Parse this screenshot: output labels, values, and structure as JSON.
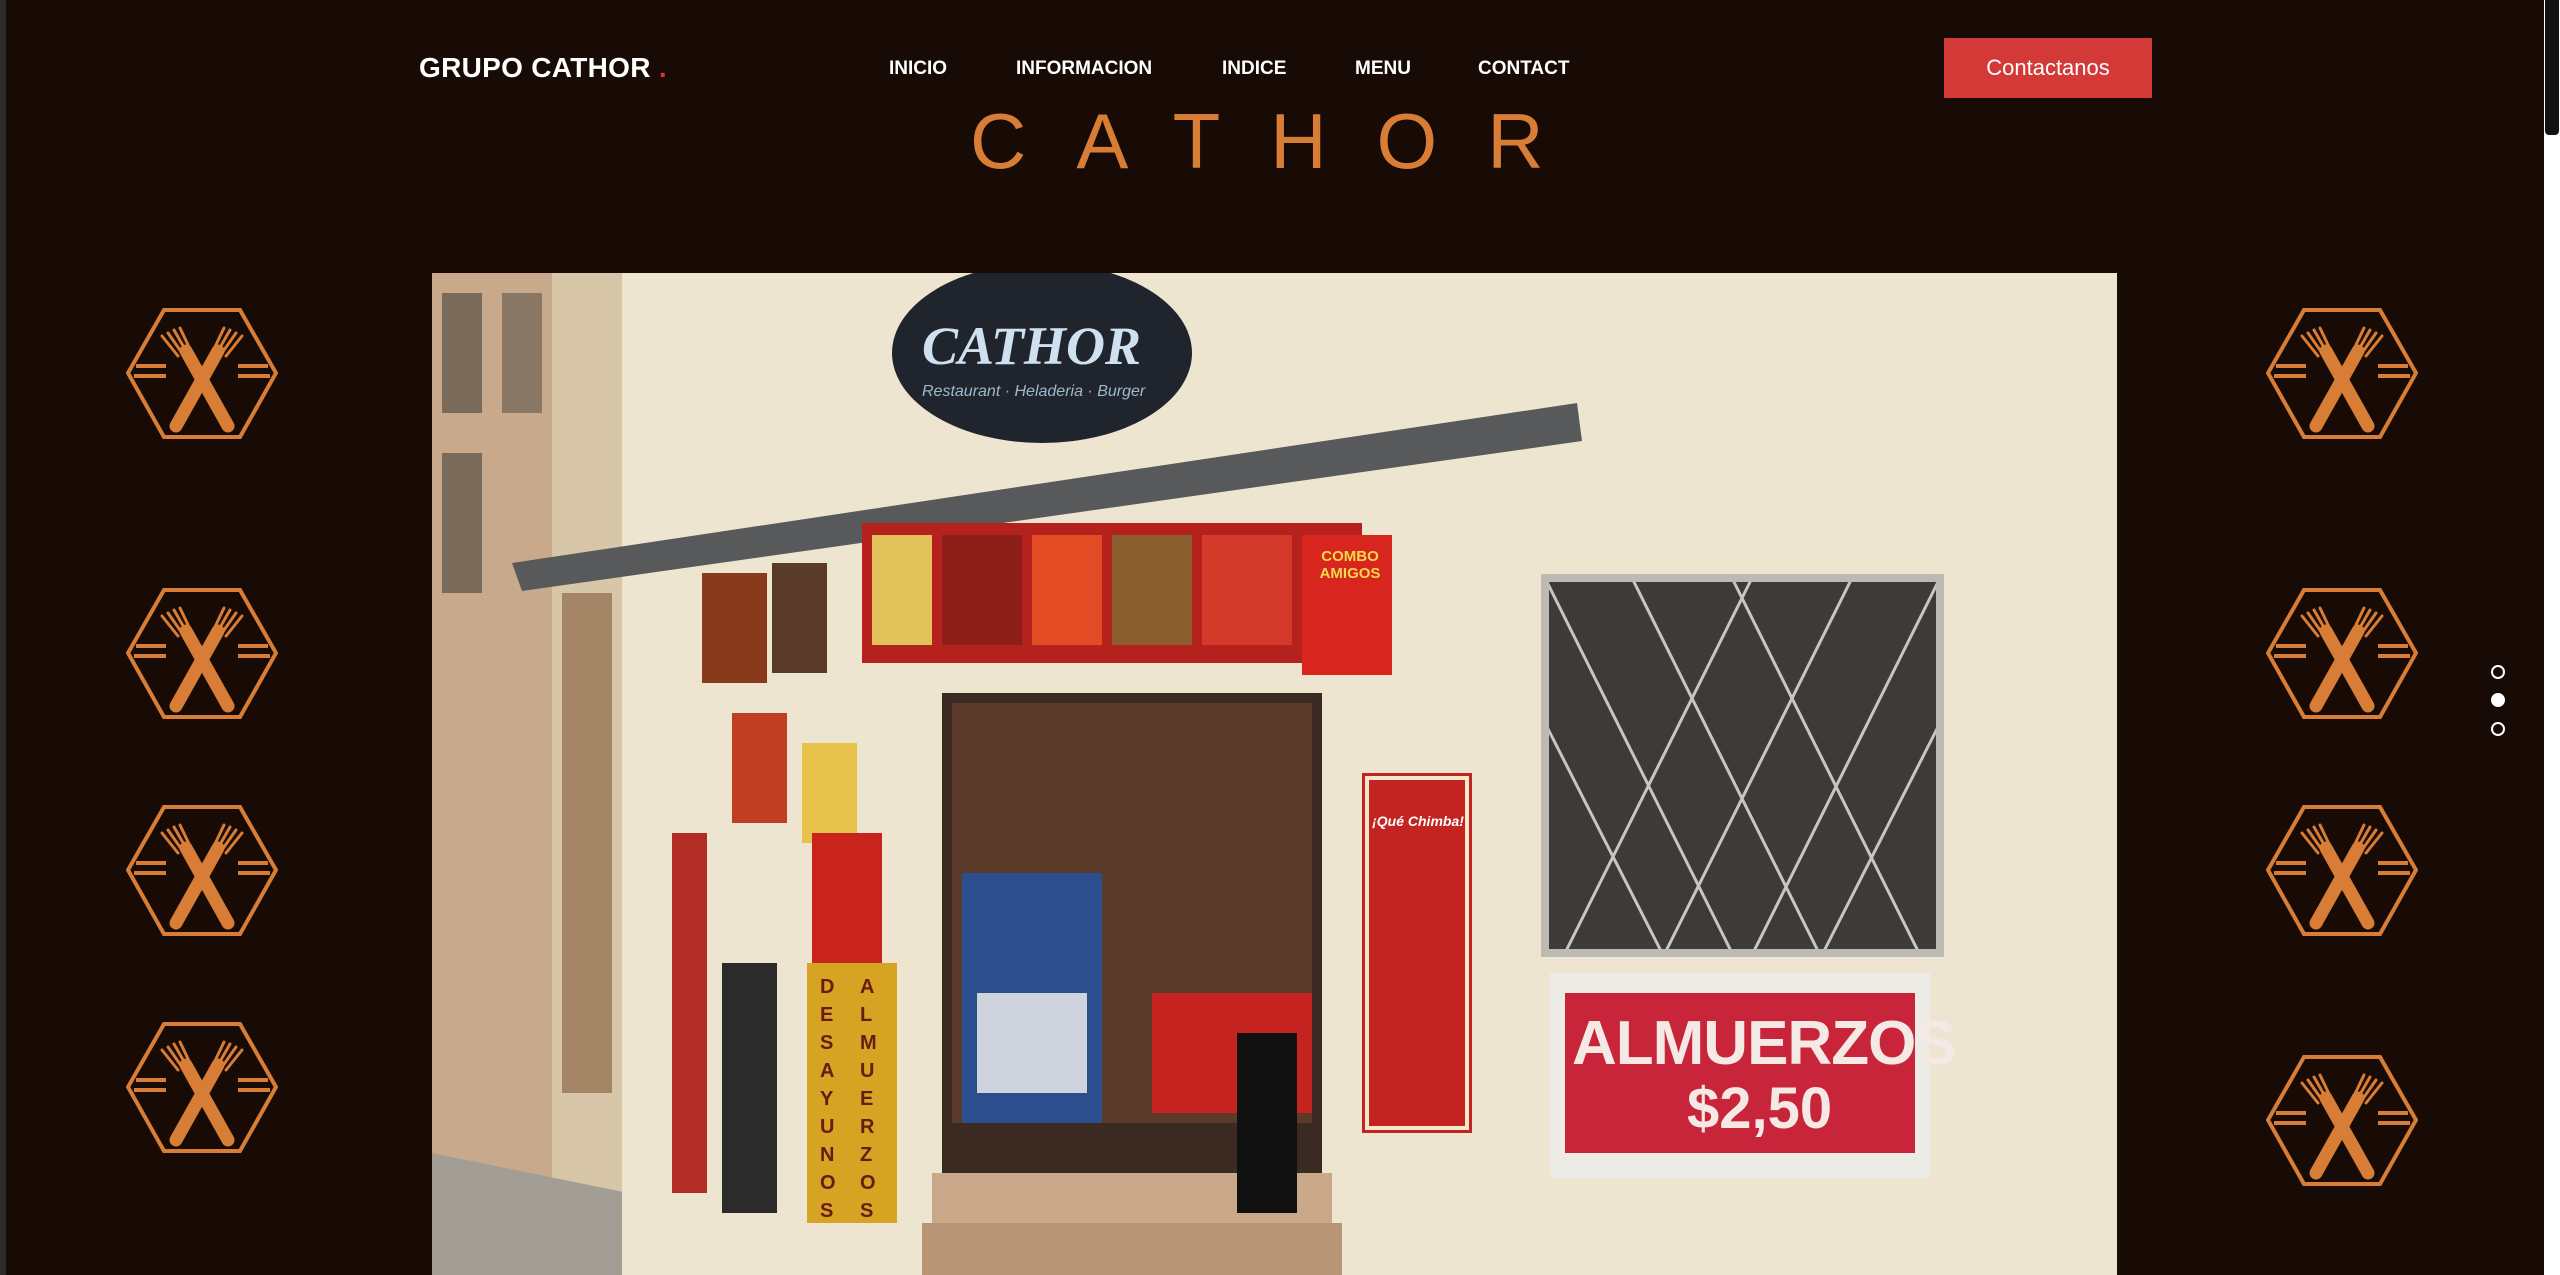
{
  "header": {
    "logo_text": "GRUPO CATHOR",
    "logo_dot": ".",
    "nav": [
      "INICIO",
      "INFORMACION",
      "INDICE",
      "MENU",
      "CONTACT"
    ],
    "cta_label": "Contactanos"
  },
  "hero": {
    "brand": "CATHOR"
  },
  "photo_signs": {
    "store_sign": "CATHOR",
    "store_sign_sub": "Restaurant · Heladeria · Burger",
    "almuerzos": "ALMUERZOS",
    "price": "$2,50",
    "desayunos": "DESAYUNOS",
    "almuerzos_vertical": "ALMUERZOS",
    "combo": "COMBO AMIGOS",
    "que_chimba": "¡Qué Chimba!"
  },
  "carousel": {
    "slides": 3,
    "active": 2
  },
  "colors": {
    "background": "#180a05",
    "accent": "#d77d35",
    "cta": "#d33a37"
  },
  "icons": {
    "emblem": "crossed-fork-knife-hexagon-icon"
  }
}
